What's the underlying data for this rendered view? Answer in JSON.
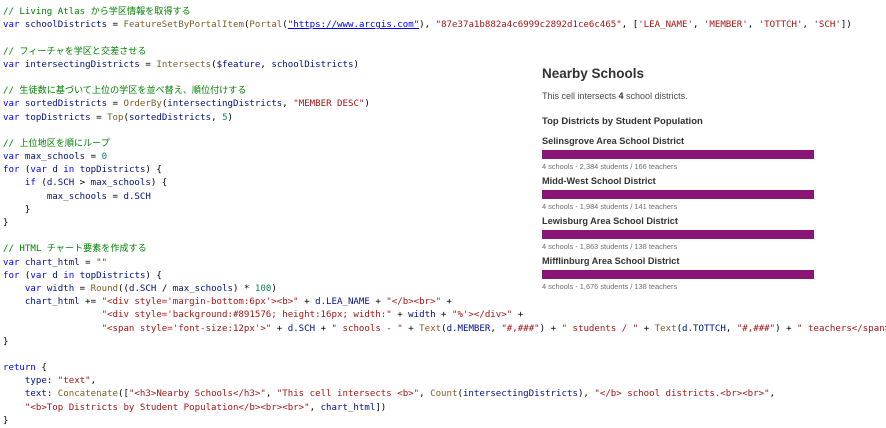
{
  "code": {
    "lines": [
      [
        [
          "cm",
          "// Living Atlas から学区情報を取得する"
        ]
      ],
      [
        [
          "kw",
          "var"
        ],
        [
          "op",
          " "
        ],
        [
          "id",
          "schoolDistricts"
        ],
        [
          "op",
          " = "
        ],
        [
          "fn",
          "FeatureSetByPortalItem"
        ],
        [
          "op",
          "("
        ],
        [
          "fn",
          "Portal"
        ],
        [
          "op",
          "("
        ],
        [
          "url",
          "\"https://www.arcgis.com\""
        ],
        [
          "op",
          "), "
        ],
        [
          "st",
          "\"87e37a1b882a4c6999c2892d1ce6c465\""
        ],
        [
          "op",
          ", ["
        ],
        [
          "st",
          "'LEA_NAME'"
        ],
        [
          "op",
          ", "
        ],
        [
          "st",
          "'MEMBER'"
        ],
        [
          "op",
          ", "
        ],
        [
          "st",
          "'TOTTCH'"
        ],
        [
          "op",
          ", "
        ],
        [
          "st",
          "'SCH'"
        ],
        [
          "op",
          "])"
        ]
      ],
      [
        [
          "op",
          " "
        ]
      ],
      [
        [
          "cm",
          "// フィーチャを学区と交差させる"
        ]
      ],
      [
        [
          "kw",
          "var"
        ],
        [
          "op",
          " "
        ],
        [
          "id",
          "intersectingDistricts"
        ],
        [
          "op",
          " = "
        ],
        [
          "fn",
          "Intersects"
        ],
        [
          "op",
          "("
        ],
        [
          "id",
          "$feature"
        ],
        [
          "op",
          ", "
        ],
        [
          "id",
          "schoolDistricts"
        ],
        [
          "op",
          ")"
        ]
      ],
      [
        [
          "op",
          " "
        ]
      ],
      [
        [
          "cm",
          "// 生徒数に基づいて上位の学区を並べ替え、順位付けする"
        ]
      ],
      [
        [
          "kw",
          "var"
        ],
        [
          "op",
          " "
        ],
        [
          "id",
          "sortedDistricts"
        ],
        [
          "op",
          " = "
        ],
        [
          "fn",
          "OrderBy"
        ],
        [
          "op",
          "("
        ],
        [
          "id",
          "intersectingDistricts"
        ],
        [
          "op",
          ", "
        ],
        [
          "st",
          "\"MEMBER DESC\""
        ],
        [
          "op",
          ")"
        ]
      ],
      [
        [
          "kw",
          "var"
        ],
        [
          "op",
          " "
        ],
        [
          "id",
          "topDistricts"
        ],
        [
          "op",
          " = "
        ],
        [
          "fn",
          "Top"
        ],
        [
          "op",
          "("
        ],
        [
          "id",
          "sortedDistricts"
        ],
        [
          "op",
          ", "
        ],
        [
          "nm",
          "5"
        ],
        [
          "op",
          ")"
        ]
      ],
      [
        [
          "op",
          " "
        ]
      ],
      [
        [
          "cm",
          "// 上位地区を順にループ"
        ]
      ],
      [
        [
          "kw",
          "var"
        ],
        [
          "op",
          " "
        ],
        [
          "id",
          "max_schools"
        ],
        [
          "op",
          " = "
        ],
        [
          "nm",
          "0"
        ]
      ],
      [
        [
          "kw",
          "for"
        ],
        [
          "op",
          " ("
        ],
        [
          "kw",
          "var"
        ],
        [
          "op",
          " "
        ],
        [
          "id",
          "d"
        ],
        [
          "op",
          " "
        ],
        [
          "kw",
          "in"
        ],
        [
          "op",
          " "
        ],
        [
          "id",
          "topDistricts"
        ],
        [
          "op",
          ") {"
        ]
      ],
      [
        [
          "op",
          "    "
        ],
        [
          "kw",
          "if"
        ],
        [
          "op",
          " ("
        ],
        [
          "id",
          "d.SCH"
        ],
        [
          "op",
          " > "
        ],
        [
          "id",
          "max_schools"
        ],
        [
          "op",
          ") {"
        ]
      ],
      [
        [
          "op",
          "        "
        ],
        [
          "id",
          "max_schools"
        ],
        [
          "op",
          " = "
        ],
        [
          "id",
          "d.SCH"
        ]
      ],
      [
        [
          "op",
          "    }"
        ]
      ],
      [
        [
          "op",
          "}"
        ]
      ],
      [
        [
          "op",
          " "
        ]
      ],
      [
        [
          "cm",
          "// HTML チャート要素を作成する"
        ]
      ],
      [
        [
          "kw",
          "var"
        ],
        [
          "op",
          " "
        ],
        [
          "id",
          "chart_html"
        ],
        [
          "op",
          " = "
        ],
        [
          "st",
          "\"\""
        ]
      ],
      [
        [
          "kw",
          "for"
        ],
        [
          "op",
          " ("
        ],
        [
          "kw",
          "var"
        ],
        [
          "op",
          " "
        ],
        [
          "id",
          "d"
        ],
        [
          "op",
          " "
        ],
        [
          "kw",
          "in"
        ],
        [
          "op",
          " "
        ],
        [
          "id",
          "topDistricts"
        ],
        [
          "op",
          ") {"
        ]
      ],
      [
        [
          "op",
          "    "
        ],
        [
          "kw",
          "var"
        ],
        [
          "op",
          " "
        ],
        [
          "id",
          "width"
        ],
        [
          "op",
          " = "
        ],
        [
          "fn",
          "Round"
        ],
        [
          "op",
          "(("
        ],
        [
          "id",
          "d.SCH"
        ],
        [
          "op",
          " / "
        ],
        [
          "id",
          "max_schools"
        ],
        [
          "op",
          ") * "
        ],
        [
          "nm",
          "100"
        ],
        [
          "op",
          ")"
        ]
      ],
      [
        [
          "op",
          "    "
        ],
        [
          "id",
          "chart_html"
        ],
        [
          "op",
          " += "
        ],
        [
          "st",
          "\"<div style='margin-bottom:6px'><b>\""
        ],
        [
          "op",
          " + "
        ],
        [
          "id",
          "d.LEA_NAME"
        ],
        [
          "op",
          " + "
        ],
        [
          "st",
          "\"</b><br>\""
        ],
        [
          "op",
          " +"
        ]
      ],
      [
        [
          "op",
          "                  "
        ],
        [
          "st",
          "\"<div style='background:#891576; height:16px; width:\""
        ],
        [
          "op",
          " + "
        ],
        [
          "id",
          "width"
        ],
        [
          "op",
          " + "
        ],
        [
          "st",
          "\"%'></div>\""
        ],
        [
          "op",
          " +"
        ]
      ],
      [
        [
          "op",
          "                  "
        ],
        [
          "st",
          "\"<span style='font-size:12px'>\""
        ],
        [
          "op",
          " + "
        ],
        [
          "id",
          "d.SCH"
        ],
        [
          "op",
          " + "
        ],
        [
          "st",
          "\" schools - \""
        ],
        [
          "op",
          " + "
        ],
        [
          "fn",
          "Text"
        ],
        [
          "op",
          "("
        ],
        [
          "id",
          "d.MEMBER"
        ],
        [
          "op",
          ", "
        ],
        [
          "st",
          "\"#,###\""
        ],
        [
          "op",
          ") + "
        ],
        [
          "st",
          "\" students / \""
        ],
        [
          "op",
          " + "
        ],
        [
          "fn",
          "Text"
        ],
        [
          "op",
          "("
        ],
        [
          "id",
          "d.TOTTCH"
        ],
        [
          "op",
          ", "
        ],
        [
          "st",
          "\"#,###\""
        ],
        [
          "op",
          ") + "
        ],
        [
          "st",
          "\" teachers</span></div>\""
        ]
      ],
      [
        [
          "op",
          "}"
        ]
      ],
      [
        [
          "op",
          " "
        ]
      ],
      [
        [
          "kw",
          "return"
        ],
        [
          "op",
          " {"
        ]
      ],
      [
        [
          "op",
          "    "
        ],
        [
          "id",
          "type"
        ],
        [
          "op",
          ": "
        ],
        [
          "st",
          "\"text\""
        ],
        [
          "op",
          ","
        ]
      ],
      [
        [
          "op",
          "    "
        ],
        [
          "id",
          "text"
        ],
        [
          "op",
          ": "
        ],
        [
          "fn",
          "Concatenate"
        ],
        [
          "op",
          "(["
        ],
        [
          "st",
          "\"<h3>Nearby Schools</h3>\""
        ],
        [
          "op",
          ", "
        ],
        [
          "st",
          "\"This cell intersects <b>\""
        ],
        [
          "op",
          ", "
        ],
        [
          "fn",
          "Count"
        ],
        [
          "op",
          "("
        ],
        [
          "id",
          "intersectingDistricts"
        ],
        [
          "op",
          "), "
        ],
        [
          "st",
          "\"</b> school districts.<br><br>\""
        ],
        [
          "op",
          ","
        ]
      ],
      [
        [
          "op",
          "    "
        ],
        [
          "st",
          "\"<b>Top Districts by Student Population</b><br><br>\""
        ],
        [
          "op",
          ", "
        ],
        [
          "id",
          "chart_html"
        ],
        [
          "op",
          "])"
        ]
      ],
      [
        [
          "op",
          "}"
        ]
      ]
    ]
  },
  "popup": {
    "title": "Nearby Schools",
    "intro_prefix": "This cell intersects ",
    "intro_count": "4",
    "intro_suffix": " school districts.",
    "section": "Top Districts by Student Population",
    "bar_color": "#891576",
    "districts": [
      {
        "name": "Selinsgrove Area School District",
        "meta": "4 schools - 2,384 students / 166 teachers",
        "bar_fraction": 1.0
      },
      {
        "name": "Midd-West School District",
        "meta": "4 schools - 1,984 students / 141 teachers",
        "bar_fraction": 1.0
      },
      {
        "name": "Lewisburg Area School District",
        "meta": "4 schools - 1,863 students / 138 teachers",
        "bar_fraction": 1.0
      },
      {
        "name": "Mifflinburg Area School District",
        "meta": "4 schools - 1,676 students / 138 teachers",
        "bar_fraction": 1.0
      }
    ]
  }
}
